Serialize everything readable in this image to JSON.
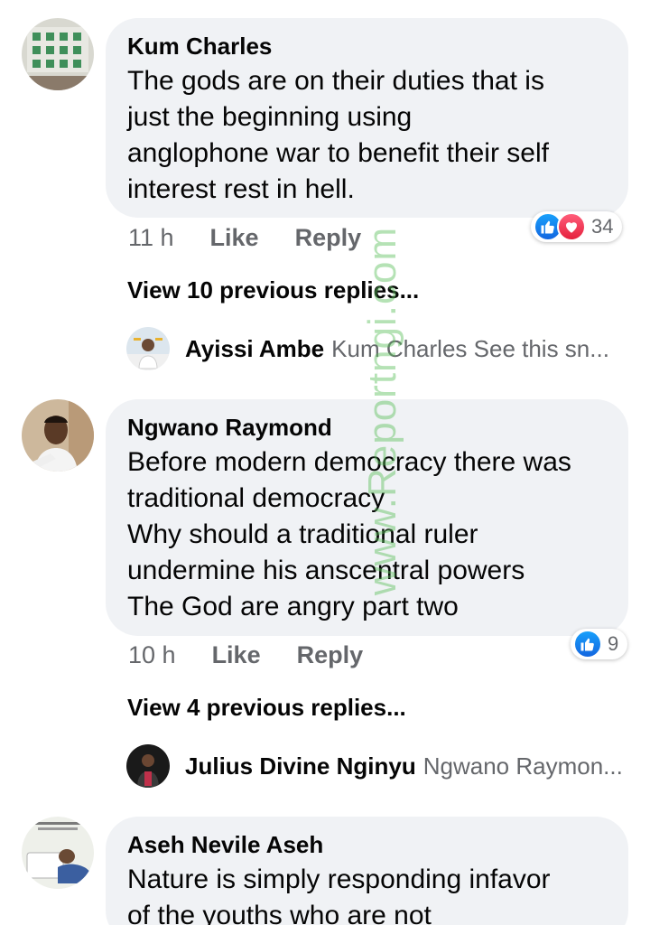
{
  "comments": [
    {
      "author": "Kum Charles",
      "text": "The  gods  are on  their duties that is\njust  the beginning  using\nanglophone  war to benefit  their self\ninterest  rest in hell.",
      "time": "11 h",
      "like_label": "Like",
      "reply_label": "Reply",
      "reaction_count": "34",
      "view_replies_label": "View 10 previous replies...",
      "latest_reply": {
        "name": "Ayissi Ambe",
        "text": "Kum Charles See this sn..."
      }
    },
    {
      "author": "Ngwano Raymond",
      "text": "Before modern democracy there was\ntraditional democracy\nWhy should a traditional ruler\nundermine his anscentral powers\nThe God are angry part two",
      "time": "10 h",
      "like_label": "Like",
      "reply_label": "Reply",
      "reaction_count": "9",
      "view_replies_label": "View 4 previous replies...",
      "latest_reply": {
        "name": "Julius Divine Nginyu",
        "text": "Ngwano Raymon..."
      }
    },
    {
      "author": "Aseh Nevile Aseh",
      "text": "Nature is simply responding infavor\nof the youths who are not"
    }
  ],
  "watermark": "www.Reportngi.com",
  "colors": {
    "bubble": "#f0f2f5",
    "secondary_text": "#65676b",
    "like_blue": "#1877f2",
    "love_red": "#f33e58"
  }
}
